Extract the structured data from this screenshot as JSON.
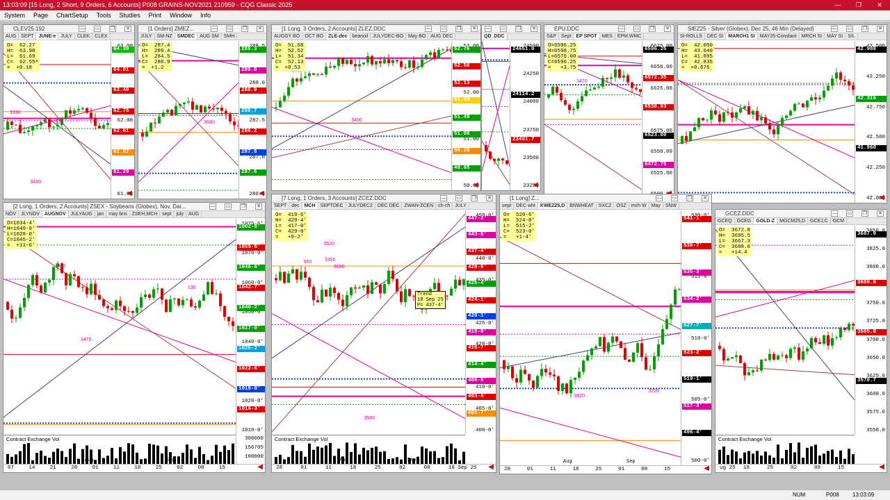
{
  "app": {
    "title": "13:03:09   [15 Long, 2 Short, 9 Orders, 6 Accounts]   P008 GRAINS-NOV2021   210959 - CQG Classic 2025",
    "menu": [
      "System",
      "Page",
      "ChartSetup",
      "Tools",
      "Studies",
      "Print",
      "Window",
      "Info"
    ]
  },
  "colors": {
    "titlebar": "#c8102e",
    "up": "#00a000",
    "down": "#e00000",
    "accent_blue": "#1040e0",
    "accent_magenta": "#e000a0"
  },
  "windows": {
    "clev": {
      "title": "CLEV25.192",
      "tabs": [
        "AUG",
        "SEPT",
        "JUNE-e",
        "JULY",
        "CLEK",
        "CLEX"
      ],
      "ohlc": "O=  62.27\nH=  63.98\nL=  61.69\nC=  62.55^\n=  +0.18",
      "yticks": [
        "63.00",
        "62.00",
        "61.00"
      ],
      "tags": [
        {
          "t": "64.39",
          "c": "#00c000"
        },
        {
          "t": "64.01",
          "c": "#e00000"
        },
        {
          "t": "63.40",
          "c": "#e00000"
        },
        {
          "t": "62.75",
          "c": "#e00000"
        },
        {
          "t": "62.61",
          "c": "#e00000"
        },
        {
          "t": "61.87",
          "c": "#ff8c00"
        },
        {
          "t": "61.29",
          "c": "#e000a0"
        }
      ],
      "notes": [
        "3430",
        "3330",
        "170"
      ]
    },
    "zmez": {
      "title": "[1 Orders]  ZMEZ...",
      "tabs": [
        "JULY",
        "SM-NZ",
        "SMDEC",
        "AUG SM",
        "SMH"
      ],
      "ohlc": "O=  287.4\nH=  289.4\nL=  284.5\nC=  288.9\n=  +1.2",
      "yticks": [
        "288.5",
        "288.0",
        "287.5",
        "287.0",
        "286.5"
      ],
      "tags": [
        {
          "t": "289.3",
          "c": "#00a000"
        },
        {
          "t": "289.0",
          "c": "#e000a0"
        },
        {
          "t": "288.9",
          "c": "#e00000"
        },
        {
          "t": "288.7",
          "c": "#00a0e0"
        },
        {
          "t": "288.2",
          "c": "#e00000"
        },
        {
          "t": "287.8",
          "c": "#0040e0"
        },
        {
          "t": "287.6",
          "c": "#00a000"
        }
      ],
      "notes": [
        "3580"
      ]
    },
    "zlez": {
      "title": "[1 Long, 3 Orders, 2 Accounts]  ZLEZ.DDC",
      "tabs": [
        "AUGGY BO",
        "OCT BO",
        "ZLE-dec",
        "beanoil",
        "JULYDEC-BO",
        "May BO",
        "AUG DEC"
      ],
      "ohlc": "O=  51.68\nH=  52.52\nL=  51.34\nC=  52.13\n=  +0.53",
      "yticks": [
        "53.00",
        "52.00",
        "51.00",
        "50.00"
      ],
      "tags": [
        {
          "t": "52.76",
          "c": "#00a000"
        },
        {
          "t": "52.50",
          "c": "#e00000"
        },
        {
          "t": "52.13",
          "c": "#e00000"
        },
        {
          "t": "51.68",
          "c": "#ffd000"
        },
        {
          "t": "51.49",
          "c": "#00a000"
        },
        {
          "t": "51.08",
          "c": "#00a000"
        },
        {
          "t": "50.28",
          "c": "#ff8c00"
        },
        {
          "t": "49.65",
          "c": "#00a000"
        }
      ],
      "notes": [
        "3460",
        "3400"
      ]
    },
    "qdc": {
      "title": "",
      "tabs": [
        "QD_DDC"
      ],
      "ohlc": "",
      "yticks": [
        "24500",
        "24250",
        "24000",
        "23750",
        "23500",
        "23250"
      ],
      "tags": [
        {
          "t": "24651.0",
          "c": "#000000"
        },
        {
          "t": "24114.2",
          "c": "#000000"
        },
        {
          "t": "23461.7",
          "c": "#e00000"
        }
      ],
      "notes": []
    },
    "epu": {
      "title": "EPU.DDC",
      "tabs": [
        "S&P",
        "Sept",
        "EP SPOT",
        "MES",
        "EPM.WMC"
      ],
      "ohlc": "O=6596.25\nH=6598.75\nL=6576.00\nC=6596.25\n=   +3.75",
      "yticks": [
        "6675.00",
        "6650.00",
        "6625.00",
        "6600.00",
        "6575.00",
        "6550.00",
        "6525.00",
        "6500.00"
      ],
      "tags": [
        {
          "t": "6596.25",
          "c": "#000000"
        },
        {
          "t": "6572.35",
          "c": "#e00000"
        },
        {
          "t": "6538.63",
          "c": "#e00000"
        },
        {
          "t": "6523.00",
          "c": "#000000"
        },
        {
          "t": "6472.75",
          "c": "#e000a0"
        }
      ],
      "notes": [
        "3470"
      ]
    },
    "sie": {
      "title": "SIEZ25 - Silver (Globex), Dec 25, 46 Min (Delayed)",
      "tabs": [
        "SI-ROLLS",
        "DEC SI",
        "MARCH1 SI",
        "MAY25-Constant",
        "MRCH SI",
        "MAY SI",
        "SIL"
      ],
      "ohlc": "O=  42.050\nH=  43.040\nL=  41.895\nC=  42.835\n=  +0.676",
      "yticks": [
        "43.500",
        "43.250",
        "42.750",
        "42.500",
        "42.250",
        "42.000"
      ],
      "tags": [
        {
          "t": "42.988",
          "c": "#000000"
        },
        {
          "t": "42.316",
          "c": "#00a000"
        },
        {
          "t": "41.960",
          "c": "#000000"
        }
      ],
      "notes": []
    },
    "zsex": {
      "title": "[2 Long, 1 Orders, 2 Accounts]  ZSEX - Soybeans (Globex), Nov, Dai...",
      "tabs": [
        "NOV",
        "JLYNOV",
        "AUGNOV",
        "JULYAUG",
        "jan",
        "may bns",
        "ZSEH,MCH",
        "sept",
        "july",
        "AUG"
      ],
      "ohlc": "O=1034-4'\nH=1049-0'\nL=1028-0'\nC=1045-2'\n=  +11-6'",
      "yticks": [
        "1075-6'",
        "1070-0'",
        "1060-0'",
        "1050-0'",
        "1040-0'",
        "1030-0'",
        "1020-0'",
        "1010-0'"
      ],
      "tags": [
        {
          "t": "1062-6'",
          "c": "#00a000"
        },
        {
          "t": "1055-5'",
          "c": "#e00000"
        },
        {
          "t": "1046-6'",
          "c": "#00a000"
        },
        {
          "t": "1042-7'",
          "c": "#e00000"
        },
        {
          "t": "1040-2'",
          "c": "#00a000"
        },
        {
          "t": "1027-0'",
          "c": "#00a000"
        },
        {
          "t": "1025-2'",
          "c": "#00a0e0"
        },
        {
          "t": "1022-6'",
          "c": "#e00000"
        },
        {
          "t": "1019-0'",
          "c": "#0040e0"
        },
        {
          "t": "1016-3'",
          "c": "#e00000"
        }
      ],
      "notes": [
        "3470",
        "3430",
        "130"
      ],
      "xlabels": [
        "07",
        "14",
        "21",
        "28",
        "01",
        "11",
        "18",
        "25",
        "02",
        "08",
        "15"
      ],
      "months": [
        "Aug",
        "Sep"
      ],
      "vol_label": "Contract Exchange Vol",
      "vol_ticks": [
        "300000",
        "156705",
        "100000"
      ]
    },
    "zcez": {
      "title": "[7 Long, 1 Orders, 3 Accounts]  ZCEZ.DDC",
      "tabs": [
        "SEPT",
        "dec",
        "MCH",
        "SEPTDEC",
        "JULYDEC2",
        "DEC DEC",
        "ZWAN-ZCEN",
        "ch-ch",
        "JULY"
      ],
      "ohlc": "O=  419-6'\nH=  429-4'\nL=  417-0'\nC=  429-0'\n=   +9-2'",
      "yticks": [
        "450-0'",
        "445-0'",
        "440-0'",
        "435-0'",
        "430-0'",
        "425-0'",
        "420-0'",
        "415-0'",
        "410-0'",
        "405-0'",
        "400-0'"
      ],
      "tags": [
        {
          "t": "447-2'",
          "c": "#e000a0"
        },
        {
          "t": "443-6'",
          "c": "#e000a0"
        },
        {
          "t": "437-4'",
          "c": "#e00000"
        },
        {
          "t": "428-6'",
          "c": "#e00000"
        },
        {
          "t": "425-4'",
          "c": "#00a000"
        },
        {
          "t": "424-1'",
          "c": "#e00000"
        },
        {
          "t": "420-1'",
          "c": "#0040e0"
        },
        {
          "t": "418-0'",
          "c": "#e000a0"
        },
        {
          "t": "416-7'",
          "c": "#e00000"
        },
        {
          "t": "414-4'",
          "c": "#00a000"
        },
        {
          "t": "408-5'",
          "c": "#e000a0"
        },
        {
          "t": "403-4'",
          "c": "#e00000"
        },
        {
          "t": "401-7'",
          "c": "#ff8c00"
        }
      ],
      "notes": [
        "3520",
        "3680",
        "3560",
        "3350",
        "960"
      ],
      "tooltip": "Trend\n18 Sep 25\nP= 437-4'",
      "xlabels": [
        "28",
        "01",
        "11",
        "18",
        "25",
        "02",
        "08",
        "18 Sep 25"
      ],
      "months": [
        "Aug",
        "Sep"
      ],
      "vol_label": "Contract Exchange Vol"
    },
    "wht": {
      "title": "[1 Long]  Z...",
      "tabs": [
        "sept",
        "DEC wht",
        "KWEZ25,D",
        "BNWHEAT",
        "SXCZ",
        "OSZ",
        "mch W",
        "May",
        "SNW"
      ],
      "ohlc": "O=  520-6'\nH=  524-0'\nL=  515-2'\nC=  523-0'\n=   +1-4'",
      "yticks": [
        "530-0'",
        "515-0'",
        "510-0'",
        "505-0'",
        "500-0'"
      ],
      "tags": [
        {
          "t": "541-1'",
          "c": "#e00000"
        },
        {
          "t": "539-7'",
          "c": "#e00000"
        },
        {
          "t": "535-3'",
          "c": "#e000a0"
        },
        {
          "t": "534-2'",
          "c": "#e000a0"
        },
        {
          "t": "527-7'",
          "c": "#00b0b0"
        },
        {
          "t": "523-2'",
          "c": "#e00000"
        },
        {
          "t": "519-1'",
          "c": "#000000"
        },
        {
          "t": "517-3'",
          "c": "#e000a0"
        },
        {
          "t": "496-4'",
          "c": "#000000"
        }
      ],
      "notes": [
        "3220",
        "3820"
      ],
      "xlabels": [
        "28",
        "01",
        "11",
        "18",
        "25",
        "01",
        "08",
        "15"
      ],
      "months": [
        "Aug",
        "Sep"
      ]
    },
    "gcez": {
      "title": "GCEZ.DDC",
      "tabs": [
        "GCEQ",
        "GCEG",
        "GOLD-Z",
        "MGCM25,D",
        "GCEJ,C",
        "GCM"
      ],
      "ohlc": "O=  3672.8\nH=  3695.5\nL=  3667.3\nC=  3688.0\n=   +14.4",
      "yticks": [
        "3850.0",
        "3825.0",
        "3800.0",
        "3775.0",
        "3750.0",
        "3725.0",
        "3700.0",
        "3650.0",
        "3625.0",
        "3600.0",
        "3575.0",
        "3550.0"
      ],
      "tags": [
        {
          "t": "3687.9",
          "c": "#000000"
        },
        {
          "t": "3680.6",
          "c": "#e00000"
        },
        {
          "t": "3585.8",
          "c": "#e00000"
        },
        {
          "t": "3570.7",
          "c": "#000000"
        }
      ],
      "notes": [
        "340"
      ],
      "xlabels": [
        "ug 25",
        "18",
        "25",
        "02",
        "08",
        "15"
      ],
      "vol_label": "Contract Exchange Vol"
    }
  },
  "status": {
    "num": "NUM",
    "page": "P008",
    "time": "13:03:09"
  }
}
